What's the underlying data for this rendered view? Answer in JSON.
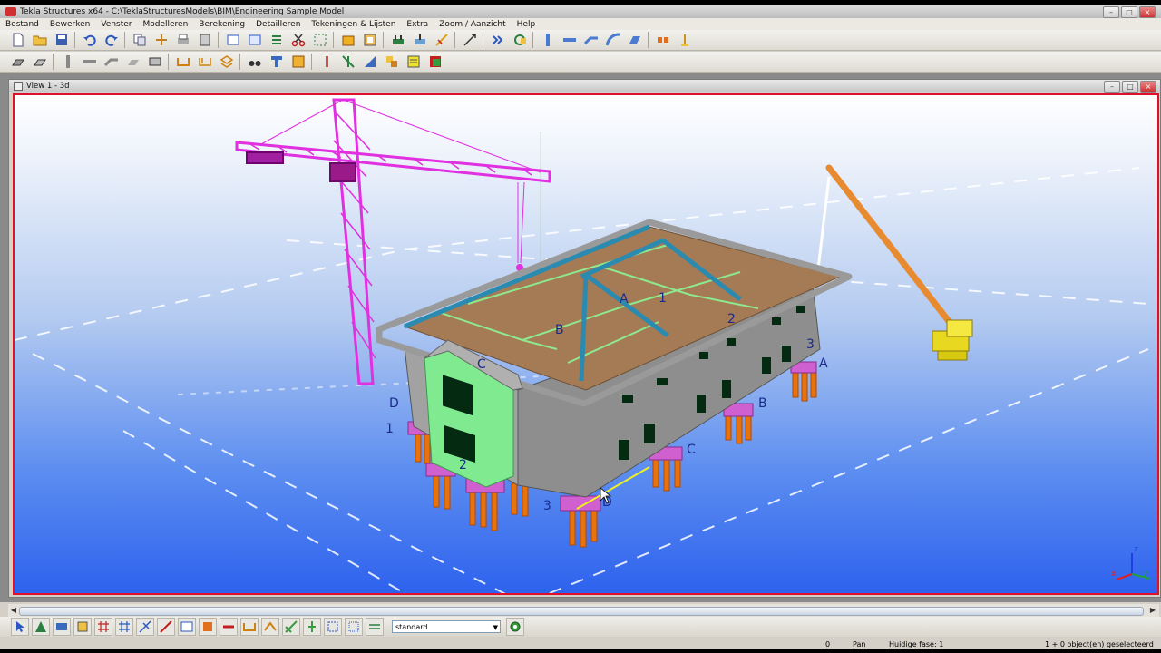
{
  "window": {
    "title": "Tekla Structures x64 - C:\\TeklaStructuresModels\\BIM\\Engineering Sample Model",
    "controls": [
      "–",
      "□",
      "×"
    ]
  },
  "menu": [
    "Bestand",
    "Bewerken",
    "Venster",
    "Modelleren",
    "Berekening",
    "Detailleren",
    "Tekeningen & Lijsten",
    "Extra",
    "Zoom / Aanzicht",
    "Help"
  ],
  "view": {
    "title": "View 1 - 3d",
    "controls": [
      "–",
      "□",
      "×"
    ]
  },
  "grid_labels": {
    "roof_a": "A",
    "roof_1": "1",
    "roof_2": "2",
    "roof_b": "B",
    "roof_c": "C",
    "left_d": "D",
    "left_1": "1",
    "gable_2": "2",
    "front_3": "3",
    "front_d": "D",
    "front_c": "C",
    "right_b": "B",
    "right_a": "A",
    "right_3": "3"
  },
  "axes": {
    "x": "x",
    "y": "y",
    "z": "z"
  },
  "bottom_toolbar": {
    "filter_value": "standard"
  },
  "status": {
    "count": "0",
    "mode": "Pan",
    "phase": "Huidige fase: 1",
    "selection": "1 + 0 object(en) geselecteerd"
  },
  "colors": {
    "selection_border": "#e0102a",
    "tower_crane": "#e030e0",
    "mobile_crane_boom": "#e88a30",
    "mobile_crane_body": "#f0e020",
    "roof": "#a47b55",
    "roof_beams": "#2a8ab0",
    "walls": "#8e8e8e",
    "gable": "#80ea90",
    "piles": "#e8720e",
    "pile_caps": "#d060d0"
  }
}
